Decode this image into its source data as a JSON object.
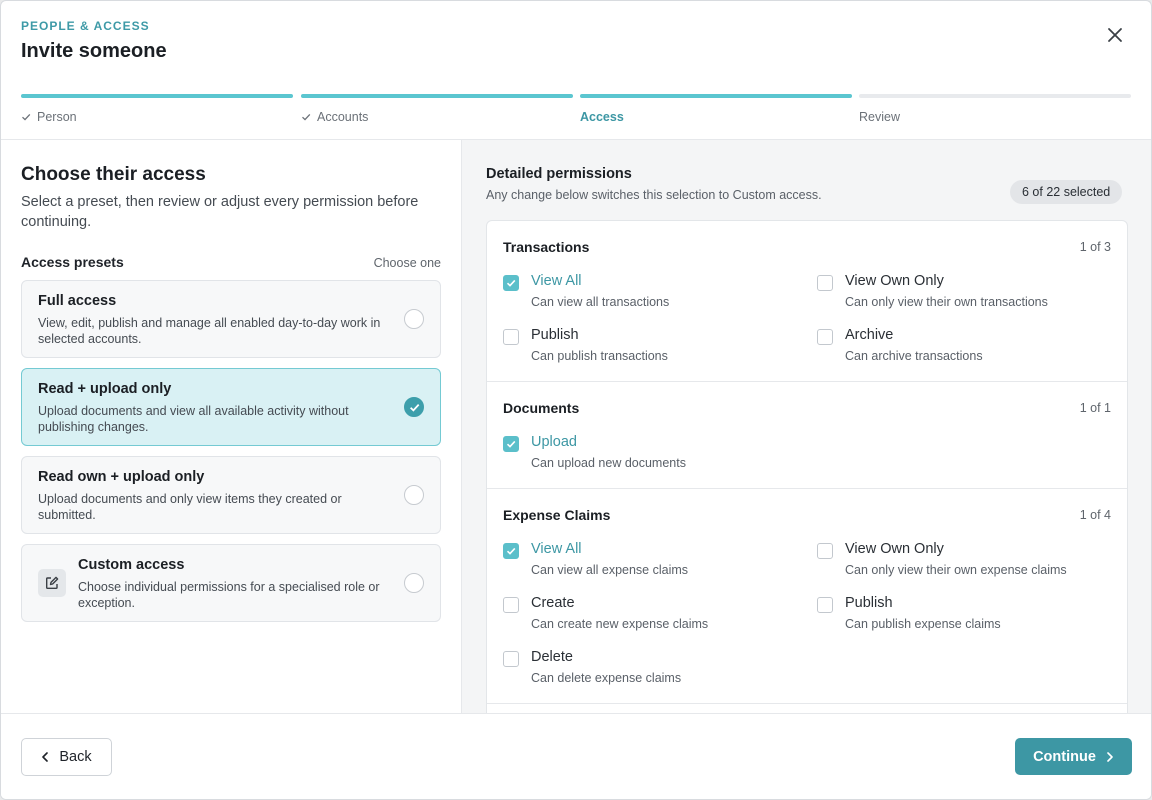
{
  "header": {
    "eyebrow": "PEOPLE & ACCESS",
    "title": "Invite someone",
    "close_icon": "close-icon"
  },
  "steps": [
    {
      "label": "Person",
      "state": "complete"
    },
    {
      "label": "Accounts",
      "state": "complete"
    },
    {
      "label": "Access",
      "state": "active"
    },
    {
      "label": "Review",
      "state": "upcoming"
    }
  ],
  "left": {
    "heading": "Choose their access",
    "lead": "Select a preset, then review or adjust every permission before continuing.",
    "presets_title": "Access presets",
    "presets_hint": "Choose one",
    "presets": [
      {
        "title": "Full access",
        "desc": "View, edit, publish and manage all enabled day-to-day work in selected accounts.",
        "selected": false
      },
      {
        "title": "Read + upload only",
        "desc": "Upload documents and view all available activity without publishing changes.",
        "selected": true
      },
      {
        "title": "Read own + upload only",
        "desc": "Upload documents and only view items they created or submitted.",
        "selected": false
      },
      {
        "title": "Custom access",
        "desc": "Choose individual permissions for a specialised role or exception.",
        "selected": false,
        "icon": "edit-icon"
      }
    ]
  },
  "right": {
    "title": "Detailed permissions",
    "subtitle": "Any change below switches this selection to Custom access.",
    "count": "6 of 22 selected",
    "groups": [
      {
        "title": "Transactions",
        "count": "1 of 3",
        "permissions": [
          {
            "name": "View All",
            "desc": "Can view all transactions",
            "checked": true
          },
          {
            "name": "View Own Only",
            "desc": "Can only view their own transactions",
            "checked": false
          },
          {
            "name": "Publish",
            "desc": "Can publish transactions",
            "checked": false
          },
          {
            "name": "Archive",
            "desc": "Can archive transactions",
            "checked": false
          }
        ]
      },
      {
        "title": "Documents",
        "count": "1 of 1",
        "permissions": [
          {
            "name": "Upload",
            "desc": "Can upload new documents",
            "checked": true
          }
        ]
      },
      {
        "title": "Expense Claims",
        "count": "1 of 4",
        "permissions": [
          {
            "name": "View All",
            "desc": "Can view all expense claims",
            "checked": true
          },
          {
            "name": "View Own Only",
            "desc": "Can only view their own expense claims",
            "checked": false
          },
          {
            "name": "Create",
            "desc": "Can create new expense claims",
            "checked": false
          },
          {
            "name": "Publish",
            "desc": "Can publish expense claims",
            "checked": false
          },
          {
            "name": "Delete",
            "desc": "Can delete expense claims",
            "checked": false
          }
        ]
      }
    ]
  },
  "footer": {
    "back_label": "Back",
    "continue_label": "Continue"
  },
  "colors": {
    "accent": "#3d97a4",
    "progress": "#5bc6d0",
    "selected_bg": "#d9f1f4"
  }
}
